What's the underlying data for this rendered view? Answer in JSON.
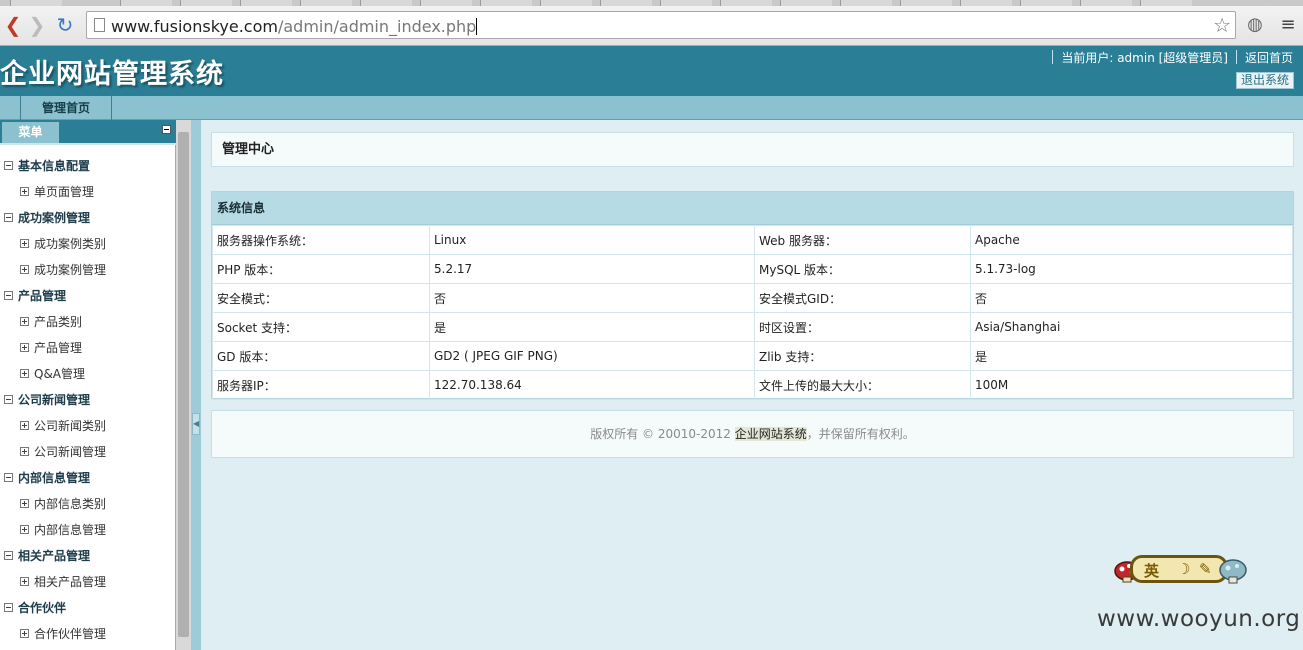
{
  "browser": {
    "url_host": "www.fusionskye.com",
    "url_path": "/admin/admin_index.php"
  },
  "header": {
    "title": "企业网站管理系统",
    "current_user": "当前用户: admin [超级管理员]",
    "home_link": "返回首页",
    "logout": "退出系统"
  },
  "nav": {
    "home_tab": "管理首页"
  },
  "sidebar": {
    "tab": "菜单",
    "groups": [
      {
        "label": "基本信息配置",
        "items": [
          "单页面管理"
        ]
      },
      {
        "label": "成功案例管理",
        "items": [
          "成功案例类别",
          "成功案例管理"
        ]
      },
      {
        "label": "产品管理",
        "items": [
          "产品类别",
          "产品管理",
          "Q&A管理"
        ]
      },
      {
        "label": "公司新闻管理",
        "items": [
          "公司新闻类别",
          "公司新闻管理"
        ]
      },
      {
        "label": "内部信息管理",
        "items": [
          "内部信息类别",
          "内部信息管理"
        ]
      },
      {
        "label": "相关产品管理",
        "items": [
          "相关产品管理"
        ]
      },
      {
        "label": "合作伙伴",
        "items": [
          "合作伙伴管理"
        ]
      }
    ]
  },
  "content": {
    "heading": "管理中心",
    "sysinfo_title": "系统信息",
    "rows": [
      [
        "服务器操作系统：",
        "Linux",
        "Web 服务器：",
        "Apache"
      ],
      [
        "PHP 版本：",
        "5.2.17",
        "MySQL 版本：",
        "5.1.73-log"
      ],
      [
        "安全模式：",
        "否",
        "安全模式GID：",
        "否"
      ],
      [
        "Socket 支持：",
        "是",
        "时区设置：",
        "Asia/Shanghai"
      ],
      [
        "GD 版本：",
        "GD2 ( JPEG GIF PNG)",
        "Zlib 支持：",
        "是"
      ],
      [
        "服务器IP：",
        "122.70.138.64",
        "文件上传的最大大小：",
        "100M"
      ]
    ],
    "footer_prefix": "版权所有 © 20010-2012 ",
    "footer_brand": "企业网站系统",
    "footer_suffix": "，并保留所有权利。"
  },
  "ime": {
    "mode": "英"
  },
  "watermark": "www.wooyun.org",
  "colors": {
    "header_bg": "#2a7f96",
    "nav_bg": "#8cc1cf",
    "content_bg": "#dfeef2",
    "table_head_bg": "#b6dbe5"
  }
}
